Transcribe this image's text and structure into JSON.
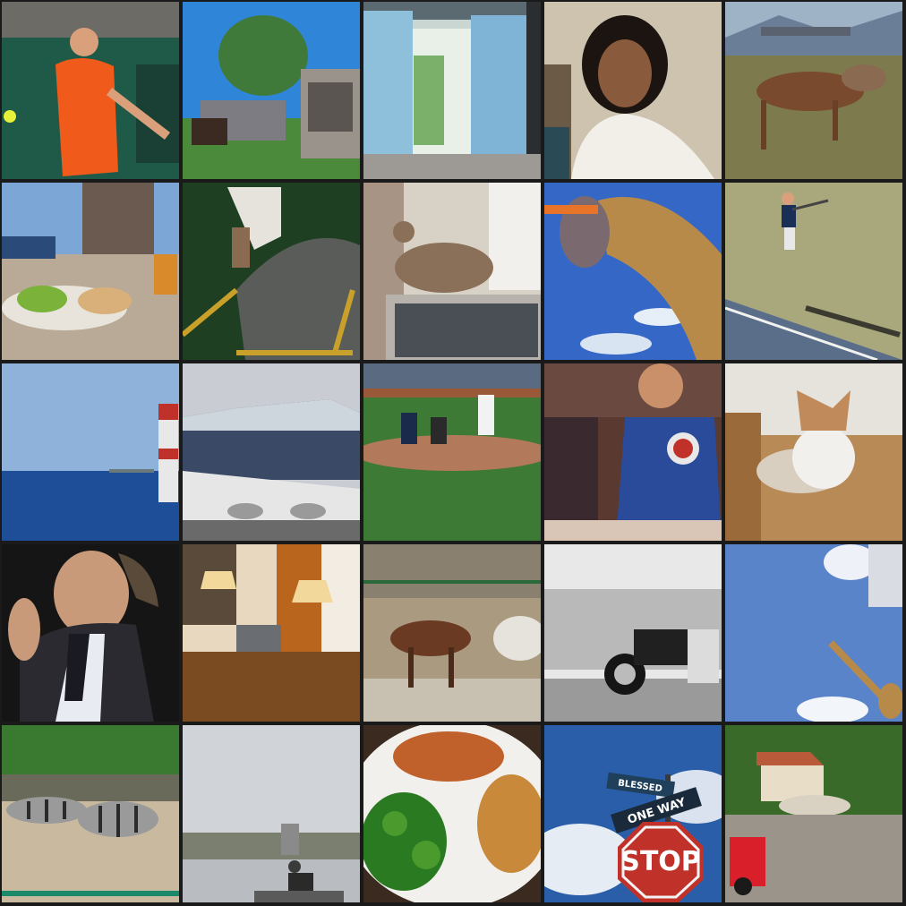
{
  "grid": {
    "rows": 5,
    "cols": 5
  },
  "tiles": [
    {
      "subject": "tennis player in orange shirt"
    },
    {
      "subject": "pickup truck and horse trailer"
    },
    {
      "subject": "window with blue curtains"
    },
    {
      "subject": "woman on phone"
    },
    {
      "subject": "cows on hillside"
    },
    {
      "subject": "plate of food with beer"
    },
    {
      "subject": "skateboarder on ramp"
    },
    {
      "subject": "dove on laptop"
    },
    {
      "subject": "giraffe licking"
    },
    {
      "subject": "tennis player on court"
    },
    {
      "subject": "lighthouse on sea"
    },
    {
      "subject": "airplane wing and mountains"
    },
    {
      "subject": "baseball game"
    },
    {
      "subject": "man in Cubs shirt"
    },
    {
      "subject": "dog on bed"
    },
    {
      "subject": "man with tie"
    },
    {
      "subject": "hotel desk with laptop and lamps"
    },
    {
      "subject": "horses in paddock"
    },
    {
      "subject": "motorcycle on beach"
    },
    {
      "subject": "giraffe under sky"
    },
    {
      "subject": "zebras"
    },
    {
      "subject": "waterfront people"
    },
    {
      "subject": "plate with chicken, broccoli and potatoes"
    },
    {
      "subject": "street signs",
      "signs": {
        "top": "BLESSED",
        "middle": "ONE WAY",
        "stop": "STOP"
      }
    },
    {
      "subject": "street with sheep and red scooter"
    }
  ]
}
